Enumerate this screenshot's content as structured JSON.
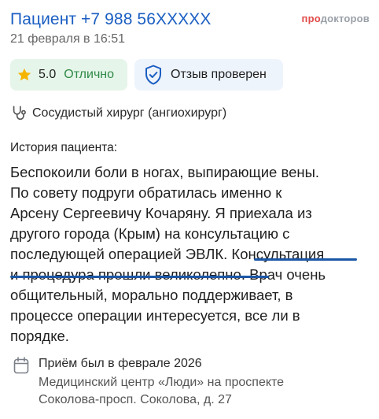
{
  "review": {
    "patient_name": "Пациент +7 988 56XXXXX",
    "date": "21 февраля в 16:51",
    "brand": {
      "part1": "про",
      "part2": "докторов"
    }
  },
  "badges": {
    "rating_value": "5.0",
    "rating_label": "Отлично",
    "verified_label": "Отзыв проверен"
  },
  "doctor": {
    "specialty": "Сосудистый хирург (ангиохирург)"
  },
  "history": {
    "title": "История пациента:",
    "lines": [
      "Беспокоили боли в ногах, выпирающие вены.",
      "По совету подруги обратилась именно к",
      "Арсену Сергеевичу Кочаряну. Я приехала из",
      "другого города (Крым) на консультацию с",
      "последующей операцией ЭВЛК. ",
      "Консультация",
      "и процедура прошли великолепно",
      ". Врач очень",
      "общительный, морально поддерживает, в",
      "процессе операции интересуется, все ли в",
      "порядке."
    ]
  },
  "visit": {
    "date": "Приём был в феврале 2026",
    "clinic_line1": "Медицинский центр «Люди» на проспекте",
    "clinic_line2": "Соколова-просп. Соколова, д. 27"
  },
  "colors": {
    "accent_blue": "#1a5ec2",
    "underline_blue": "#1b57a6",
    "rating_green": "#2e8a46",
    "rating_bg": "#e6f5ea",
    "verified_bg": "#eef4fc",
    "star": "#f5b400",
    "brand_red": "#e24b4b"
  },
  "icons": [
    "star-icon",
    "shield-check-icon",
    "stethoscope-icon",
    "calendar-icon"
  ]
}
